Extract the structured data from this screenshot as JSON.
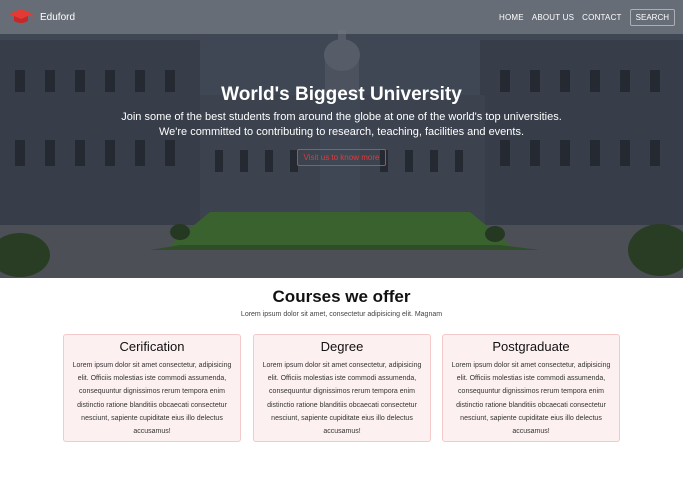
{
  "nav": {
    "brand": "Eduford",
    "links": [
      "HOME",
      "ABOUT US",
      "CONTACT"
    ],
    "search": "SEARCH"
  },
  "hero": {
    "title": "World's Biggest University",
    "subtitle_line1": "Join some of the best students from around the globe at one of the world's top universities.",
    "subtitle_line2": "We're committed to contributing to research, teaching, facilities and events.",
    "button": "Visit us to know more"
  },
  "courses": {
    "title": "Courses we offer",
    "subtitle": "Lorem ipsum dolor sit amet, consectetur adipisicing elit. Magnam",
    "cards": [
      {
        "title": "Cerification",
        "text": "Lorem ipsum dolor sit amet consectetur, adipisicing elit. Officiis molestias iste commodi assumenda, consequuntur dignissimos rerum tempora enim distinctio ratione blanditiis obcaecati consectetur nesciunt, sapiente cupiditate eius illo delectus accusamus!"
      },
      {
        "title": "Degree",
        "text": "Lorem ipsum dolor sit amet consectetur, adipisicing elit. Officiis molestias iste commodi assumenda, consequuntur dignissimos rerum tempora enim distinctio ratione blanditiis obcaecati consectetur nesciunt, sapiente cupiditate eius illo delectus accusamus!"
      },
      {
        "title": "Postgraduate",
        "text": "Lorem ipsum dolor sit amet consectetur, adipisicing elit. Officiis molestias iste commodi assumenda, consequuntur dignissimos rerum tempora enim distinctio ratione blanditiis obcaecati consectetur nesciunt, sapiente cupiditate eius illo delectus accusamus!"
      }
    ]
  },
  "colors": {
    "accent": "#e03b3b",
    "card_bg": "#fdf0f0",
    "card_border": "#f3c9c9"
  },
  "icons": [
    "graduation-cap-icon"
  ]
}
